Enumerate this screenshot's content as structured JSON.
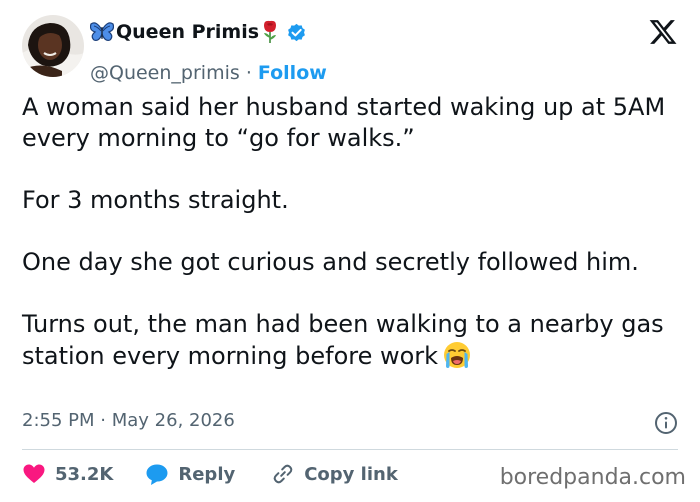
{
  "author": {
    "display_name": "Queen Primis",
    "handle": "@Queen_primis",
    "follow_label": "Follow",
    "separator": "·",
    "verified": true,
    "name_prefix_icon": "butterfly-icon",
    "name_suffix_icon": "rose-icon"
  },
  "tweet": {
    "paragraphs": [
      "A woman said her husband started waking up at 5AM every morning to “go for walks.”",
      "For 3 months straight.",
      "One day she got curious and secretly followed him.",
      "Turns out, the man had been walking to a nearby gas station every morning before work"
    ],
    "trailing_emoji": "loudly-crying-face-icon",
    "time": "2:55 PM",
    "date_separator": "·",
    "date": "May 26, 2026"
  },
  "actions": {
    "likes_count": "53.2K",
    "reply_label": "Reply",
    "copy_link_label": "Copy link"
  },
  "watermark": "boredpanda.com",
  "colors": {
    "link_blue": "#1d9bf0",
    "heart_pink": "#f91880",
    "reply_blue": "#1d9bf0",
    "secondary_text": "#536471",
    "primary_text": "#0f1419"
  }
}
